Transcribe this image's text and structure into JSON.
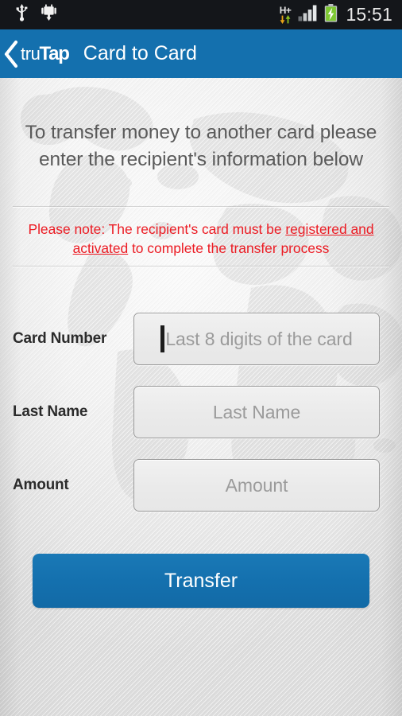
{
  "status_bar": {
    "icons_left": [
      "usb-icon",
      "android-debug-icon"
    ],
    "network_type": "H+",
    "icons_right": [
      "data-transfer-arrows-icon",
      "signal-bars-icon",
      "battery-charging-icon"
    ],
    "time": "15:51",
    "background_color": "#14161A"
  },
  "action_bar": {
    "back_icon": "back-chevron-icon",
    "brand_part1": "tru",
    "brand_part2": "Tap",
    "title": "Card to Card",
    "background_color": "#1470AE"
  },
  "content": {
    "instruction": "To transfer money to another card please enter the recipient's information below",
    "note_prefix": "Please note: The recipient's card must be ",
    "note_link": "registered and activated",
    "note_suffix": " to complete the transfer process",
    "note_color": "#EC1C24",
    "watermark": "world-map-watermark"
  },
  "form": {
    "fields": [
      {
        "label": "Card Number",
        "placeholder": "Last 8 digits of the card",
        "value": "",
        "focused": true
      },
      {
        "label": "Last Name",
        "placeholder": "Last Name",
        "value": "",
        "focused": false
      },
      {
        "label": "Amount",
        "placeholder": "Amount",
        "value": "",
        "focused": false
      }
    ]
  },
  "actions": {
    "transfer_label": "Transfer",
    "transfer_color": "#1470AE"
  }
}
